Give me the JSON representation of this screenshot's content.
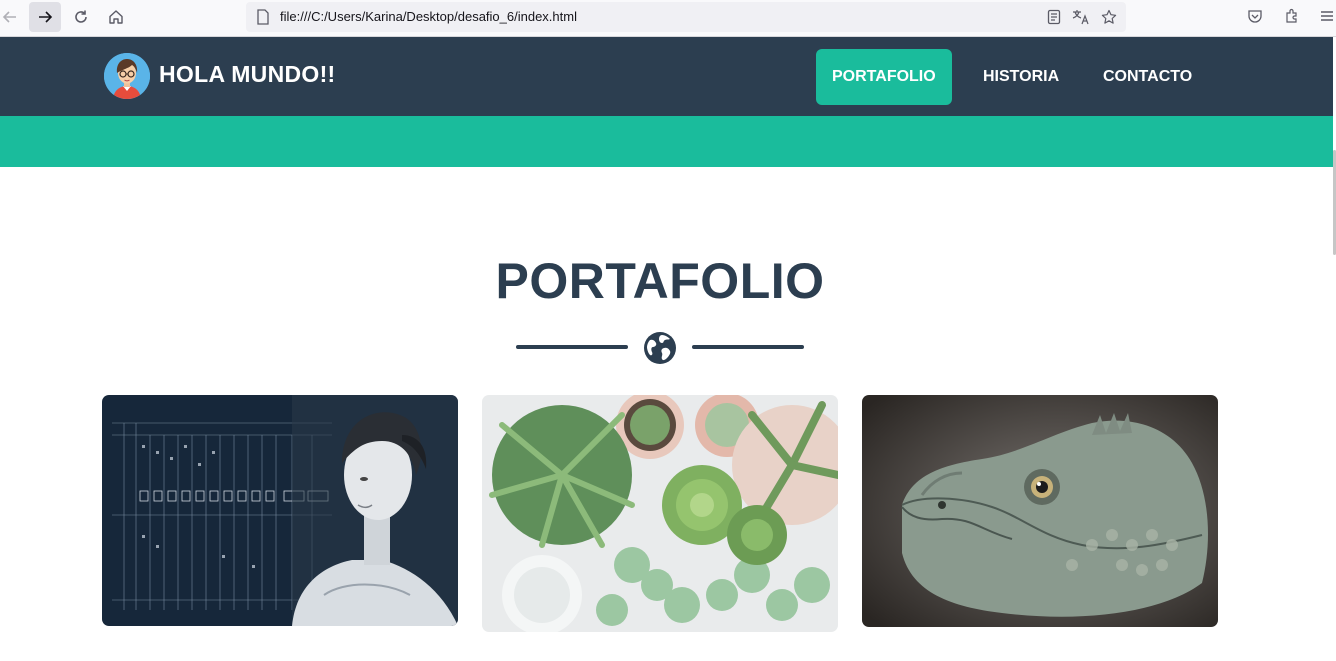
{
  "browser": {
    "url": "file:///C:/Users/Karina/Desktop/desafio_6/index.html",
    "icons": [
      "back-icon",
      "forward-icon",
      "reload-icon",
      "home-icon",
      "page-icon",
      "reader-view-icon",
      "translate-icon",
      "bookmark-star-icon",
      "pocket-icon",
      "extensions-icon",
      "menu-icon"
    ]
  },
  "header": {
    "brand": "HOLA MUNDO!!",
    "nav": [
      {
        "label": "PORTAFOLIO",
        "active": true
      },
      {
        "label": "HISTORIA",
        "active": false
      },
      {
        "label": "CONTACTO",
        "active": false
      }
    ]
  },
  "main": {
    "title": "PORTAFOLIO",
    "divider_icon": "globe-icon"
  },
  "portfolio": {
    "items": [
      {
        "subject": "portrait with handwritten data table"
      },
      {
        "subject": "succulent plants in pots"
      },
      {
        "subject": "iguana head close-up"
      }
    ]
  },
  "colors": {
    "header_bg": "#2c3e50",
    "accent": "#1abc9c",
    "title": "#2c3e50",
    "white": "#ffffff"
  }
}
